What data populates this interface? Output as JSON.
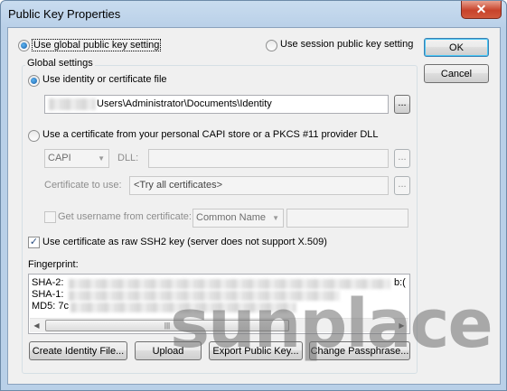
{
  "window": {
    "title": "Public Key Properties",
    "close_glyph": "✕"
  },
  "scope": {
    "global_label": "Use global public key setting",
    "session_label": "Use session public key setting",
    "selected": "global"
  },
  "buttons": {
    "ok": "OK",
    "cancel": "Cancel"
  },
  "global_settings": {
    "title": "Global settings",
    "identity_radio": "Use identity or certificate file",
    "identity_path": "Users\\Administrator\\Documents\\Identity",
    "browse": "...",
    "capi_radio": "Use a certificate from your personal CAPI store or a PKCS #11 provider DLL",
    "provider_value": "CAPI",
    "dll_label": "DLL:",
    "cert_label": "Certificate to use:",
    "cert_value": "<Try all certificates>",
    "username_label": "Get username from certificate:",
    "username_value": "Common Name",
    "raw_ssh2_label": "Use certificate as raw SSH2 key (server does not support X.509)",
    "raw_ssh2_checked": true,
    "fingerprint_label": "Fingerprint:",
    "fingerprints": [
      {
        "prefix": "SHA-2: ",
        "tail": "b:("
      },
      {
        "prefix": "SHA-1: ",
        "tail": ""
      },
      {
        "prefix": "MD5: 7c",
        "tail": ""
      }
    ]
  },
  "actions": {
    "create": "Create Identity File...",
    "upload": "Upload",
    "export": "Export Public Key...",
    "change": "Change Passphrase..."
  },
  "watermark": "sunplace",
  "icons": {
    "close": "close-icon",
    "scroll_left": "arrow-left-icon",
    "scroll_right": "arrow-right-icon",
    "dropdown": "chevron-down-icon"
  }
}
